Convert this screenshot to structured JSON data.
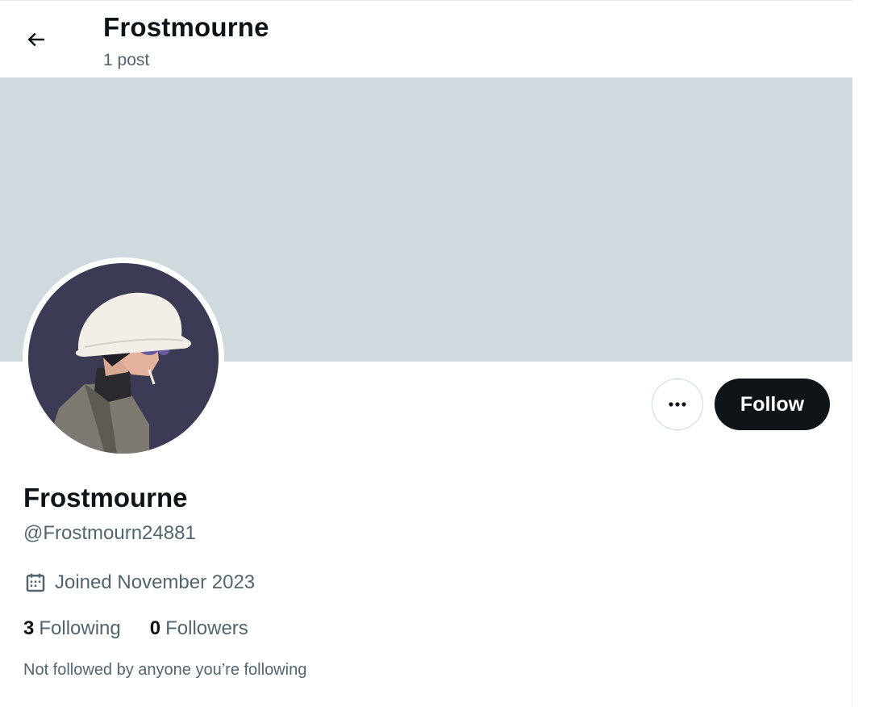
{
  "header": {
    "title": "Frostmourne",
    "post_count": "1 post"
  },
  "profile": {
    "display_name": "Frostmourne",
    "handle": "@Frostmourn24881",
    "joined": "Joined November 2023",
    "following_count": "3",
    "following_label": "Following",
    "followers_count": "0",
    "followers_label": "Followers",
    "followed_by_note": "Not followed by anyone you’re following"
  },
  "actions": {
    "follow_label": "Follow"
  },
  "icons": {
    "back": "arrow-left-icon",
    "more": "more-horizontal-icon",
    "calendar": "calendar-icon"
  },
  "colors": {
    "banner": "#cfd9de",
    "primary_text": "#0f1419",
    "secondary_text": "#536471",
    "follow_button_bg": "#0f1419",
    "avatar_bg": "#3b3b55"
  }
}
